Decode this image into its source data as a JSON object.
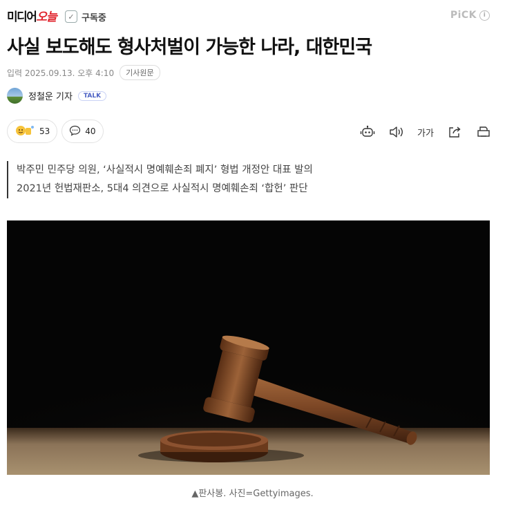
{
  "header": {
    "logo_text_a": "미디어",
    "logo_text_b": "오늘",
    "subscribe_label": "구독중",
    "pick_label": "PiCK",
    "pick_info": "i"
  },
  "article": {
    "title": "사실 보도해도 형사처벌이 가능한 나라, 대한민국",
    "date_label": "입력 2025.09.13. 오후 4:10",
    "original_button": "기사원문",
    "reporter_name": "정철운 기자",
    "talk_badge": "TALK",
    "reaction_count": "53",
    "comment_count": "40",
    "font_size_label": "가가",
    "summary": [
      "박주민 민주당 의원, ‘사실적시 명예훼손죄 폐지’ 형법 개정안 대표 발의",
      "2021년 헌법재판소, 5대4 의견으로 사실적시 명예훼손죄 ‘합헌’ 판단"
    ],
    "caption": "▲판사봉. 사진=Gettyimages."
  },
  "icons": {
    "reaction": "reaction-emoji-icon",
    "comment": "comment-bubble-icon",
    "robot": "robot-summary-icon",
    "speaker": "text-to-speech-icon",
    "font": "font-size-icon",
    "share": "share-icon",
    "print": "print-icon"
  },
  "colors": {
    "logo_red": "#e0232c",
    "talk_blue": "#4b61c4",
    "photo_bg": "#050505",
    "gavel_wood": "#7a4524"
  }
}
